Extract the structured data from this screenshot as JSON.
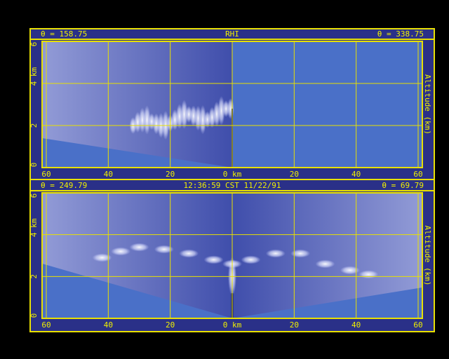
{
  "colors": {
    "frame": "#e8e000",
    "text": "#f0f000",
    "panel_bg": "#2a3088",
    "sky": "#4a70c8"
  },
  "panel_top": {
    "left_angle": "θ = 158.75",
    "center": "RHI",
    "right_angle": "θ = 338.75"
  },
  "panel_bottom": {
    "left_angle": "θ = 249.79",
    "center": "12:36:59 CST 11/22/91",
    "right_angle": "θ = 69.79"
  },
  "chart_data": [
    {
      "type": "heatmap",
      "title": "RHI",
      "x_tick_labels": [
        "60",
        "40",
        "20",
        "0 km",
        "20",
        "40",
        "60"
      ],
      "y_tick_labels": [
        "0",
        "2",
        "4",
        "6"
      ],
      "xlim": [
        -60,
        60
      ],
      "ylim": [
        0,
        6
      ],
      "y_unit_label": "km",
      "ylabel_right": "Altitude (km)",
      "grid": true
    },
    {
      "type": "heatmap",
      "title": "12:36:59 CST 11/22/91",
      "x_tick_labels": [
        "60",
        "40",
        "20",
        "0 km",
        "20",
        "40",
        "60"
      ],
      "y_tick_labels": [
        "0",
        "2",
        "4",
        "6"
      ],
      "xlim": [
        -60,
        60
      ],
      "ylim": [
        0,
        6
      ],
      "y_unit_label": "km",
      "ylabel_right": "Altitude (km)",
      "grid": true
    }
  ]
}
